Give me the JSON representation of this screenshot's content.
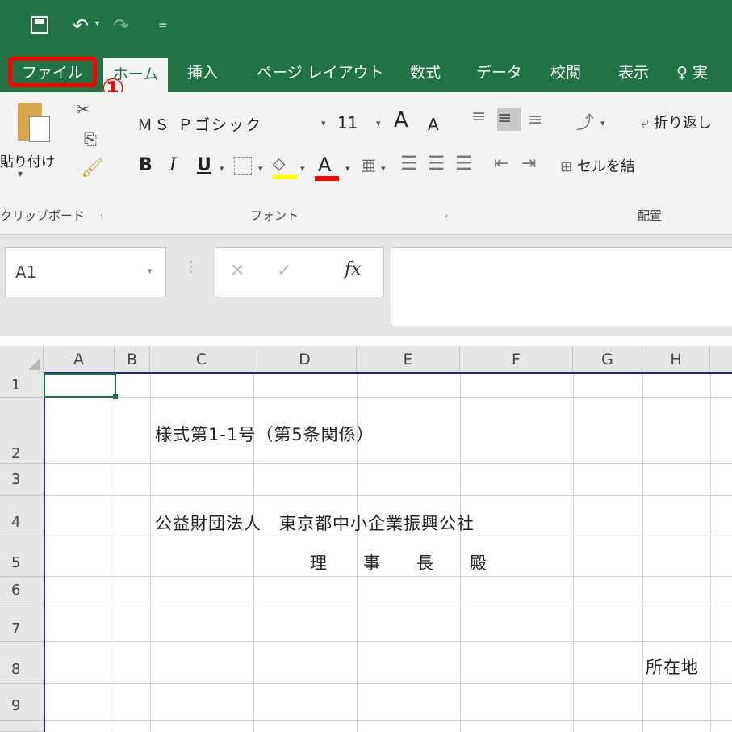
{
  "quick_access": {
    "undo_dropdown": "▾",
    "customize": "="
  },
  "tabs": [
    {
      "label": "ファイル"
    },
    {
      "label": "ホーム"
    },
    {
      "label": "挿入"
    },
    {
      "label": "ページ レイアウト"
    },
    {
      "label": "数式"
    },
    {
      "label": "データ"
    },
    {
      "label": "校閲"
    },
    {
      "label": "表示"
    },
    {
      "label": "実"
    }
  ],
  "callout": "①",
  "ribbon": {
    "paste_label": "貼り付け",
    "font_name": "ＭＳ Ｐゴシック",
    "font_size": "11",
    "grow_font": "A",
    "shrink_font": "A",
    "bold": "B",
    "italic": "I",
    "underline": "U",
    "font_color_letter": "A",
    "wrap_text": "折り返し",
    "merge_cells": "セルを結",
    "groups": {
      "clipboard": "クリップボード",
      "font": "フォント",
      "alignment": "配置"
    }
  },
  "formula_bar": {
    "name_box": "A1",
    "fx": "fx",
    "value": ""
  },
  "sheet": {
    "columns": [
      "A",
      "B",
      "C",
      "D",
      "E",
      "F",
      "G",
      "H"
    ],
    "rows": [
      "1",
      "2",
      "3",
      "4",
      "5",
      "6",
      "7",
      "8",
      "9"
    ],
    "cells": {
      "c2": "様式第1-1号（第5条関係）",
      "c4": "公益財団法人　東京都中小企業振興公社",
      "d5": "理　　事　　長　　殿",
      "h8": "所在地"
    }
  },
  "colors": {
    "brand": "#217346",
    "highlight_border": "#ff0000",
    "font_highlight": "#ffff00",
    "font_color": "#ff0000",
    "print_area": "#1f1fb0"
  }
}
